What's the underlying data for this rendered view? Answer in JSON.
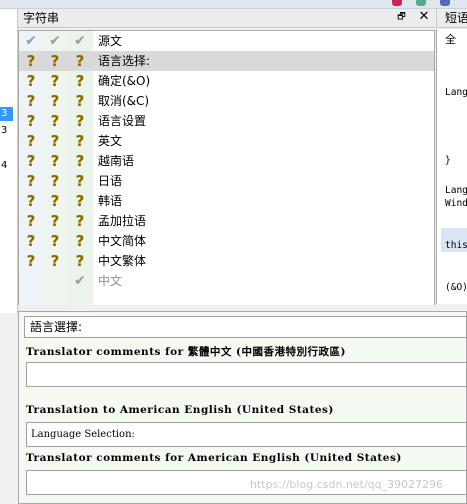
{
  "strings_pane": {
    "title": "字符串",
    "restore_glyph": "🗗",
    "close_glyph": "✕",
    "header_row": {
      "source": "源文"
    },
    "rows": [
      {
        "icons": [
          "question",
          "question",
          "question"
        ],
        "source": "语言选择:",
        "selected": true
      },
      {
        "icons": [
          "question",
          "question",
          "question"
        ],
        "source": "确定(&O)"
      },
      {
        "icons": [
          "question",
          "question",
          "question"
        ],
        "source": "取消(&C)"
      },
      {
        "icons": [
          "question",
          "question",
          "question"
        ],
        "source": "语言设置"
      },
      {
        "icons": [
          "question",
          "question",
          "question"
        ],
        "source": "英文"
      },
      {
        "icons": [
          "question",
          "question",
          "question"
        ],
        "source": "越南语"
      },
      {
        "icons": [
          "question",
          "question",
          "question"
        ],
        "source": "日语"
      },
      {
        "icons": [
          "question",
          "question",
          "question"
        ],
        "source": "韩语"
      },
      {
        "icons": [
          "question",
          "question",
          "question"
        ],
        "source": "孟加拉语"
      },
      {
        "icons": [
          "question",
          "question",
          "question"
        ],
        "source": "中文简体"
      },
      {
        "icons": [
          "question",
          "question",
          "question"
        ],
        "source": "中文繁体"
      },
      {
        "icons": [
          "",
          "",
          "check"
        ],
        "source": "中文",
        "disabled": true
      }
    ]
  },
  "left_rail": {
    "items": [
      {
        "text": "3",
        "selected": true
      },
      {
        "text": "3"
      },
      {
        "text": "4"
      }
    ]
  },
  "right_pane": {
    "title": "短语",
    "lines": [
      "全",
      "Lang",
      "}",
      "Lang",
      "Windo",
      "this",
      "(&O)"
    ]
  },
  "editor": {
    "source_text": "語言選擇:",
    "comments_zh_label": "Translator comments for 繁體中文 (中國香港特別行政區)",
    "translation_label": "Translation to American English (United States)",
    "translation_value": "Language Selection:",
    "comments_en_label": "Translator comments for American English (United States)"
  },
  "watermark": "https://blog.csdn.net/qq_39027296",
  "colors": {
    "selection": "#3399ff",
    "row_selected": "#d9d9d9",
    "icon_column": "#eaf4ea",
    "highlight": "#dbe6f4"
  }
}
